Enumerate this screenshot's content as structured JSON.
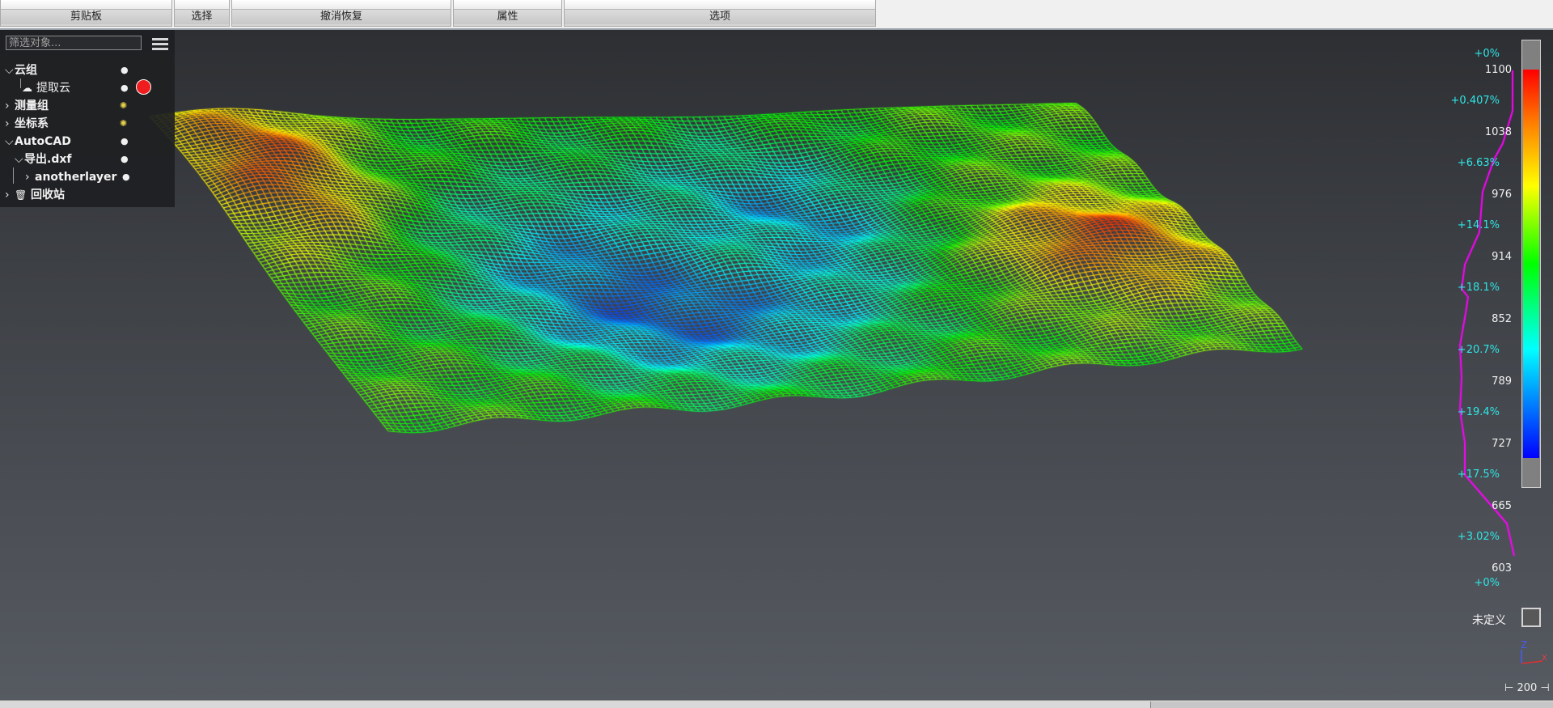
{
  "ribbon": {
    "groups": [
      {
        "label": "剪贴板"
      },
      {
        "label": "选择"
      },
      {
        "label": "撤消恢复"
      },
      {
        "label": "属性"
      },
      {
        "label": "选项"
      }
    ]
  },
  "tree": {
    "filter_placeholder": "筛选对象...",
    "items": [
      {
        "label": "云组"
      },
      {
        "label": "提取云"
      },
      {
        "label": "测量组"
      },
      {
        "label": "坐标系"
      },
      {
        "label": "AutoCAD"
      },
      {
        "label": "导出.dxf"
      },
      {
        "label": "anotherlayer"
      },
      {
        "label": "回收站"
      }
    ],
    "selected_color": "#ef1d1d"
  },
  "scale": {
    "ticks": [
      "1100",
      "1038",
      "976",
      "914",
      "852",
      "789",
      "727",
      "665",
      "603"
    ],
    "percentages": [
      "+0%",
      "+0.407%",
      "+6.63%",
      "+14.1%",
      "+18.1%",
      "+20.7%",
      "+19.4%",
      "+17.5%",
      "+3.02%",
      "+0%"
    ],
    "undefined_label": "未定义",
    "histogram_color": "#ff00ff",
    "percent_color": "#2fe6e6"
  },
  "axis": {
    "z": "Z",
    "x": "X"
  },
  "scale_bar": "⊢ 200 ⊣"
}
